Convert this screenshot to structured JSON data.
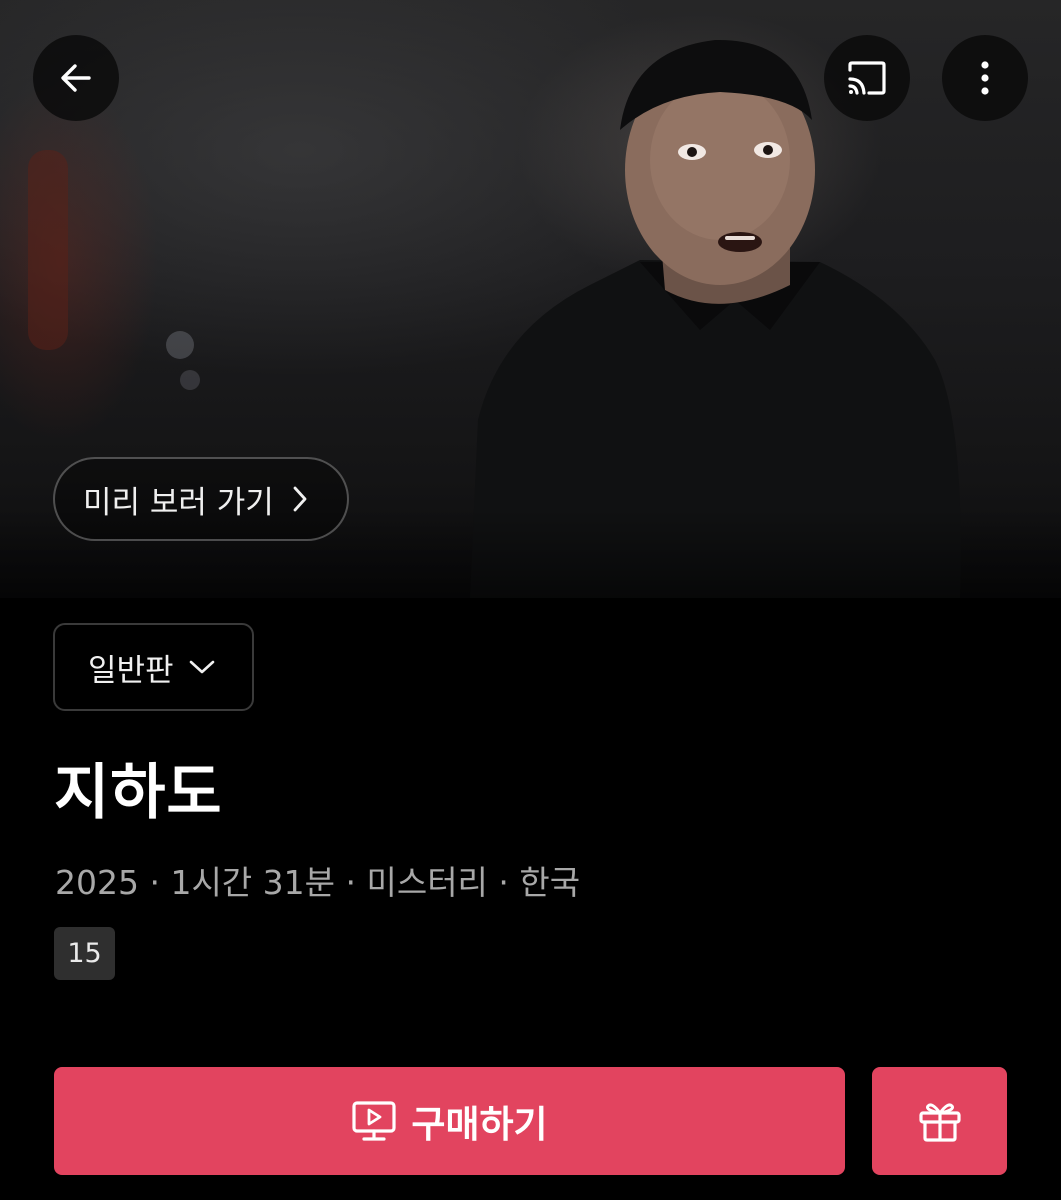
{
  "hero": {
    "preview_label": "미리 보러 가기"
  },
  "icons": {
    "back": "arrow-left-icon",
    "cast": "cast-icon",
    "more": "more-vertical-icon",
    "preview_chevron": "chevron-right-icon",
    "edition_chevron": "chevron-down-icon",
    "buy": "play-screen-icon",
    "gift": "gift-icon"
  },
  "edition": {
    "selected": "일반판"
  },
  "movie": {
    "title": "지하도",
    "meta": "2025 · 1시간 31분 · 미스터리 · 한국",
    "rating": "15"
  },
  "actions": {
    "buy_label": "구매하기"
  },
  "colors": {
    "accent": "#e2445f",
    "background": "#000000",
    "meta_text": "#a8a8a8",
    "rating_bg": "#2f2f2f"
  }
}
